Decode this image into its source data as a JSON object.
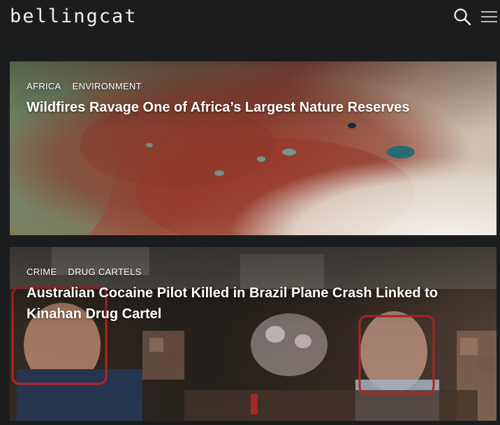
{
  "header": {
    "logo_text": "bellingcat",
    "search_icon": "search-icon",
    "menu_icon": "hamburger-menu-icon"
  },
  "articles": [
    {
      "tags": [
        "AFRICA",
        "ENVIRONMENT"
      ],
      "title": "Wildfires Ravage One of Africa’s Largest Nature Reserves",
      "image_icon": "satellite-image"
    },
    {
      "tags": [
        "CRIME",
        "DRUG CARTELS"
      ],
      "title": "Australian Cocaine Pilot Killed in Brazil Plane Crash Linked to Kinahan Drug Cartel",
      "image_icon": "photo-image"
    }
  ],
  "colors": {
    "background": "#1b1c1e",
    "text": "#ffffff",
    "highlight_box": "#d0282d"
  }
}
